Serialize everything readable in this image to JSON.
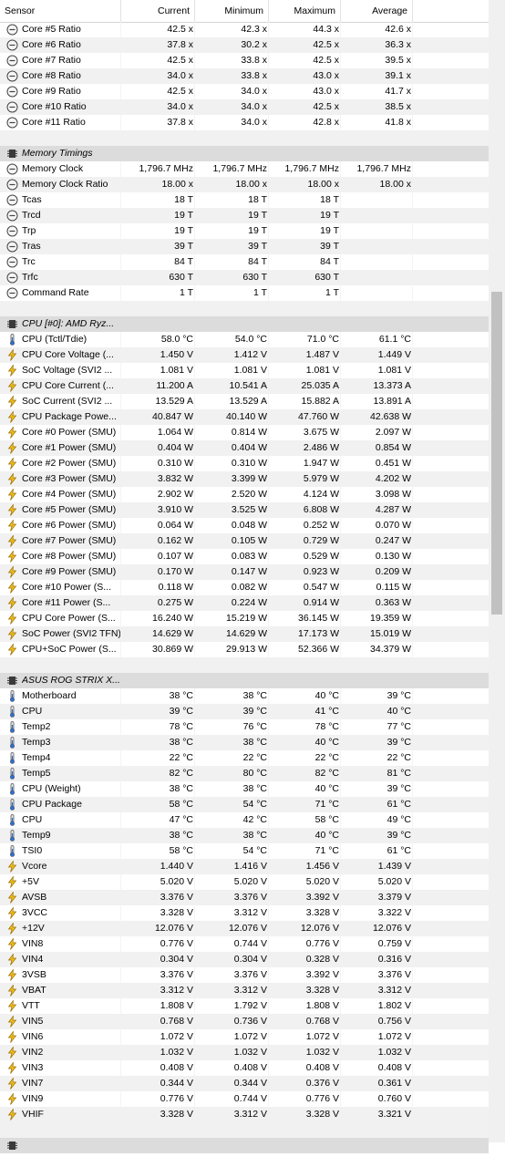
{
  "columns": {
    "sensor": "Sensor",
    "current": "Current",
    "minimum": "Minimum",
    "maximum": "Maximum",
    "average": "Average"
  },
  "rows": [
    {
      "kind": "data",
      "icon": "clock-icon",
      "label": "Core #5 Ratio",
      "cur": "42.5 x",
      "min": "42.3 x",
      "max": "44.3 x",
      "avg": "42.6 x"
    },
    {
      "kind": "data",
      "icon": "clock-icon",
      "label": "Core #6 Ratio",
      "cur": "37.8 x",
      "min": "30.2 x",
      "max": "42.5 x",
      "avg": "36.3 x"
    },
    {
      "kind": "data",
      "icon": "clock-icon",
      "label": "Core #7 Ratio",
      "cur": "42.5 x",
      "min": "33.8 x",
      "max": "42.5 x",
      "avg": "39.5 x"
    },
    {
      "kind": "data",
      "icon": "clock-icon",
      "label": "Core #8 Ratio",
      "cur": "34.0 x",
      "min": "33.8 x",
      "max": "43.0 x",
      "avg": "39.1 x"
    },
    {
      "kind": "data",
      "icon": "clock-icon",
      "label": "Core #9 Ratio",
      "cur": "42.5 x",
      "min": "34.0 x",
      "max": "43.0 x",
      "avg": "41.7 x"
    },
    {
      "kind": "data",
      "icon": "clock-icon",
      "label": "Core #10 Ratio",
      "cur": "34.0 x",
      "min": "34.0 x",
      "max": "42.5 x",
      "avg": "38.5 x"
    },
    {
      "kind": "data",
      "icon": "clock-icon",
      "label": "Core #11 Ratio",
      "cur": "37.8 x",
      "min": "34.0 x",
      "max": "42.8 x",
      "avg": "41.8 x"
    },
    {
      "kind": "blank"
    },
    {
      "kind": "group",
      "icon": "chip-icon",
      "label": "Memory Timings"
    },
    {
      "kind": "data",
      "icon": "clock-icon",
      "label": "Memory Clock",
      "cur": "1,796.7 MHz",
      "min": "1,796.7 MHz",
      "max": "1,796.7 MHz",
      "avg": "1,796.7 MHz"
    },
    {
      "kind": "data",
      "icon": "clock-icon",
      "label": "Memory Clock Ratio",
      "cur": "18.00 x",
      "min": "18.00 x",
      "max": "18.00 x",
      "avg": "18.00 x"
    },
    {
      "kind": "data",
      "icon": "clock-icon",
      "label": "Tcas",
      "cur": "18 T",
      "min": "18 T",
      "max": "18 T",
      "avg": ""
    },
    {
      "kind": "data",
      "icon": "clock-icon",
      "label": "Trcd",
      "cur": "19 T",
      "min": "19 T",
      "max": "19 T",
      "avg": ""
    },
    {
      "kind": "data",
      "icon": "clock-icon",
      "label": "Trp",
      "cur": "19 T",
      "min": "19 T",
      "max": "19 T",
      "avg": ""
    },
    {
      "kind": "data",
      "icon": "clock-icon",
      "label": "Tras",
      "cur": "39 T",
      "min": "39 T",
      "max": "39 T",
      "avg": ""
    },
    {
      "kind": "data",
      "icon": "clock-icon",
      "label": "Trc",
      "cur": "84 T",
      "min": "84 T",
      "max": "84 T",
      "avg": ""
    },
    {
      "kind": "data",
      "icon": "clock-icon",
      "label": "Trfc",
      "cur": "630 T",
      "min": "630 T",
      "max": "630 T",
      "avg": ""
    },
    {
      "kind": "data",
      "icon": "clock-icon",
      "label": "Command Rate",
      "cur": "1 T",
      "min": "1 T",
      "max": "1 T",
      "avg": ""
    },
    {
      "kind": "blank"
    },
    {
      "kind": "group",
      "icon": "chip-icon",
      "label": "CPU [#0]: AMD Ryz..."
    },
    {
      "kind": "data",
      "icon": "thermometer-icon",
      "label": "CPU (Tctl/Tdie)",
      "cur": "58.0 °C",
      "min": "54.0 °C",
      "max": "71.0 °C",
      "avg": "61.1 °C"
    },
    {
      "kind": "data",
      "icon": "lightning-icon",
      "label": "CPU Core Voltage (...",
      "cur": "1.450 V",
      "min": "1.412 V",
      "max": "1.487 V",
      "avg": "1.449 V"
    },
    {
      "kind": "data",
      "icon": "lightning-icon",
      "label": "SoC Voltage (SVI2 ...",
      "cur": "1.081 V",
      "min": "1.081 V",
      "max": "1.081 V",
      "avg": "1.081 V"
    },
    {
      "kind": "data",
      "icon": "lightning-icon",
      "label": "CPU Core Current (...",
      "cur": "11.200 A",
      "min": "10.541 A",
      "max": "25.035 A",
      "avg": "13.373 A"
    },
    {
      "kind": "data",
      "icon": "lightning-icon",
      "label": "SoC Current (SVI2 ...",
      "cur": "13.529 A",
      "min": "13.529 A",
      "max": "15.882 A",
      "avg": "13.891 A"
    },
    {
      "kind": "data",
      "icon": "lightning-icon",
      "label": "CPU Package Powe...",
      "cur": "40.847 W",
      "min": "40.140 W",
      "max": "47.760 W",
      "avg": "42.638 W"
    },
    {
      "kind": "data",
      "icon": "lightning-icon",
      "label": "Core #0 Power (SMU)",
      "cur": "1.064 W",
      "min": "0.814 W",
      "max": "3.675 W",
      "avg": "2.097 W"
    },
    {
      "kind": "data",
      "icon": "lightning-icon",
      "label": "Core #1 Power (SMU)",
      "cur": "0.404 W",
      "min": "0.404 W",
      "max": "2.486 W",
      "avg": "0.854 W"
    },
    {
      "kind": "data",
      "icon": "lightning-icon",
      "label": "Core #2 Power (SMU)",
      "cur": "0.310 W",
      "min": "0.310 W",
      "max": "1.947 W",
      "avg": "0.451 W"
    },
    {
      "kind": "data",
      "icon": "lightning-icon",
      "label": "Core #3 Power (SMU)",
      "cur": "3.832 W",
      "min": "3.399 W",
      "max": "5.979 W",
      "avg": "4.202 W"
    },
    {
      "kind": "data",
      "icon": "lightning-icon",
      "label": "Core #4 Power (SMU)",
      "cur": "2.902 W",
      "min": "2.520 W",
      "max": "4.124 W",
      "avg": "3.098 W"
    },
    {
      "kind": "data",
      "icon": "lightning-icon",
      "label": "Core #5 Power (SMU)",
      "cur": "3.910 W",
      "min": "3.525 W",
      "max": "6.808 W",
      "avg": "4.287 W"
    },
    {
      "kind": "data",
      "icon": "lightning-icon",
      "label": "Core #6 Power (SMU)",
      "cur": "0.064 W",
      "min": "0.048 W",
      "max": "0.252 W",
      "avg": "0.070 W"
    },
    {
      "kind": "data",
      "icon": "lightning-icon",
      "label": "Core #7 Power (SMU)",
      "cur": "0.162 W",
      "min": "0.105 W",
      "max": "0.729 W",
      "avg": "0.247 W"
    },
    {
      "kind": "data",
      "icon": "lightning-icon",
      "label": "Core #8 Power (SMU)",
      "cur": "0.107 W",
      "min": "0.083 W",
      "max": "0.529 W",
      "avg": "0.130 W"
    },
    {
      "kind": "data",
      "icon": "lightning-icon",
      "label": "Core #9 Power (SMU)",
      "cur": "0.170 W",
      "min": "0.147 W",
      "max": "0.923 W",
      "avg": "0.209 W"
    },
    {
      "kind": "data",
      "icon": "lightning-icon",
      "label": "Core #10 Power (S...",
      "cur": "0.118 W",
      "min": "0.082 W",
      "max": "0.547 W",
      "avg": "0.115 W"
    },
    {
      "kind": "data",
      "icon": "lightning-icon",
      "label": "Core #11 Power (S...",
      "cur": "0.275 W",
      "min": "0.224 W",
      "max": "0.914 W",
      "avg": "0.363 W"
    },
    {
      "kind": "data",
      "icon": "lightning-icon",
      "label": "CPU Core Power (S...",
      "cur": "16.240 W",
      "min": "15.219 W",
      "max": "36.145 W",
      "avg": "19.359 W"
    },
    {
      "kind": "data",
      "icon": "lightning-icon",
      "label": "SoC Power (SVI2 TFN)",
      "cur": "14.629 W",
      "min": "14.629 W",
      "max": "17.173 W",
      "avg": "15.019 W"
    },
    {
      "kind": "data",
      "icon": "lightning-icon",
      "label": "CPU+SoC Power (S...",
      "cur": "30.869 W",
      "min": "29.913 W",
      "max": "52.366 W",
      "avg": "34.379 W"
    },
    {
      "kind": "blank"
    },
    {
      "kind": "group",
      "icon": "chip-icon",
      "label": "ASUS ROG STRIX X..."
    },
    {
      "kind": "data",
      "icon": "thermometer-icon",
      "label": "Motherboard",
      "cur": "38 °C",
      "min": "38 °C",
      "max": "40 °C",
      "avg": "39 °C"
    },
    {
      "kind": "data",
      "icon": "thermometer-icon",
      "label": "CPU",
      "cur": "39 °C",
      "min": "39 °C",
      "max": "41 °C",
      "avg": "40 °C"
    },
    {
      "kind": "data",
      "icon": "thermometer-icon",
      "label": "Temp2",
      "cur": "78 °C",
      "min": "76 °C",
      "max": "78 °C",
      "avg": "77 °C"
    },
    {
      "kind": "data",
      "icon": "thermometer-icon",
      "label": "Temp3",
      "cur": "38 °C",
      "min": "38 °C",
      "max": "40 °C",
      "avg": "39 °C"
    },
    {
      "kind": "data",
      "icon": "thermometer-icon",
      "label": "Temp4",
      "cur": "22 °C",
      "min": "22 °C",
      "max": "22 °C",
      "avg": "22 °C"
    },
    {
      "kind": "data",
      "icon": "thermometer-icon",
      "label": "Temp5",
      "cur": "82 °C",
      "min": "80 °C",
      "max": "82 °C",
      "avg": "81 °C"
    },
    {
      "kind": "data",
      "icon": "thermometer-icon",
      "label": "CPU (Weight)",
      "cur": "38 °C",
      "min": "38 °C",
      "max": "40 °C",
      "avg": "39 °C"
    },
    {
      "kind": "data",
      "icon": "thermometer-icon",
      "label": "CPU Package",
      "cur": "58 °C",
      "min": "54 °C",
      "max": "71 °C",
      "avg": "61 °C"
    },
    {
      "kind": "data",
      "icon": "thermometer-icon",
      "label": "CPU",
      "cur": "47 °C",
      "min": "42 °C",
      "max": "58 °C",
      "avg": "49 °C"
    },
    {
      "kind": "data",
      "icon": "thermometer-icon",
      "label": "Temp9",
      "cur": "38 °C",
      "min": "38 °C",
      "max": "40 °C",
      "avg": "39 °C"
    },
    {
      "kind": "data",
      "icon": "thermometer-icon",
      "label": "TSI0",
      "cur": "58 °C",
      "min": "54 °C",
      "max": "71 °C",
      "avg": "61 °C"
    },
    {
      "kind": "data",
      "icon": "lightning-icon",
      "label": "Vcore",
      "cur": "1.440 V",
      "min": "1.416 V",
      "max": "1.456 V",
      "avg": "1.439 V"
    },
    {
      "kind": "data",
      "icon": "lightning-icon",
      "label": "+5V",
      "cur": "5.020 V",
      "min": "5.020 V",
      "max": "5.020 V",
      "avg": "5.020 V"
    },
    {
      "kind": "data",
      "icon": "lightning-icon",
      "label": "AVSB",
      "cur": "3.376 V",
      "min": "3.376 V",
      "max": "3.392 V",
      "avg": "3.379 V"
    },
    {
      "kind": "data",
      "icon": "lightning-icon",
      "label": "3VCC",
      "cur": "3.328 V",
      "min": "3.312 V",
      "max": "3.328 V",
      "avg": "3.322 V"
    },
    {
      "kind": "data",
      "icon": "lightning-icon",
      "label": "+12V",
      "cur": "12.076 V",
      "min": "12.076 V",
      "max": "12.076 V",
      "avg": "12.076 V"
    },
    {
      "kind": "data",
      "icon": "lightning-icon",
      "label": "VIN8",
      "cur": "0.776 V",
      "min": "0.744 V",
      "max": "0.776 V",
      "avg": "0.759 V"
    },
    {
      "kind": "data",
      "icon": "lightning-icon",
      "label": "VIN4",
      "cur": "0.304 V",
      "min": "0.304 V",
      "max": "0.328 V",
      "avg": "0.316 V"
    },
    {
      "kind": "data",
      "icon": "lightning-icon",
      "label": "3VSB",
      "cur": "3.376 V",
      "min": "3.376 V",
      "max": "3.392 V",
      "avg": "3.376 V"
    },
    {
      "kind": "data",
      "icon": "lightning-icon",
      "label": "VBAT",
      "cur": "3.312 V",
      "min": "3.312 V",
      "max": "3.328 V",
      "avg": "3.312 V"
    },
    {
      "kind": "data",
      "icon": "lightning-icon",
      "label": "VTT",
      "cur": "1.808 V",
      "min": "1.792 V",
      "max": "1.808 V",
      "avg": "1.802 V"
    },
    {
      "kind": "data",
      "icon": "lightning-icon",
      "label": "VIN5",
      "cur": "0.768 V",
      "min": "0.736 V",
      "max": "0.768 V",
      "avg": "0.756 V"
    },
    {
      "kind": "data",
      "icon": "lightning-icon",
      "label": "VIN6",
      "cur": "1.072 V",
      "min": "1.072 V",
      "max": "1.072 V",
      "avg": "1.072 V"
    },
    {
      "kind": "data",
      "icon": "lightning-icon",
      "label": "VIN2",
      "cur": "1.032 V",
      "min": "1.032 V",
      "max": "1.032 V",
      "avg": "1.032 V"
    },
    {
      "kind": "data",
      "icon": "lightning-icon",
      "label": "VIN3",
      "cur": "0.408 V",
      "min": "0.408 V",
      "max": "0.408 V",
      "avg": "0.408 V"
    },
    {
      "kind": "data",
      "icon": "lightning-icon",
      "label": "VIN7",
      "cur": "0.344 V",
      "min": "0.344 V",
      "max": "0.376 V",
      "avg": "0.361 V"
    },
    {
      "kind": "data",
      "icon": "lightning-icon",
      "label": "VIN9",
      "cur": "0.776 V",
      "min": "0.744 V",
      "max": "0.776 V",
      "avg": "0.760 V"
    },
    {
      "kind": "data",
      "icon": "lightning-icon",
      "label": "VHIF",
      "cur": "3.328 V",
      "min": "3.312 V",
      "max": "3.328 V",
      "avg": "3.321 V"
    },
    {
      "kind": "blank"
    },
    {
      "kind": "group",
      "icon": "chip-icon",
      "label": ""
    }
  ]
}
